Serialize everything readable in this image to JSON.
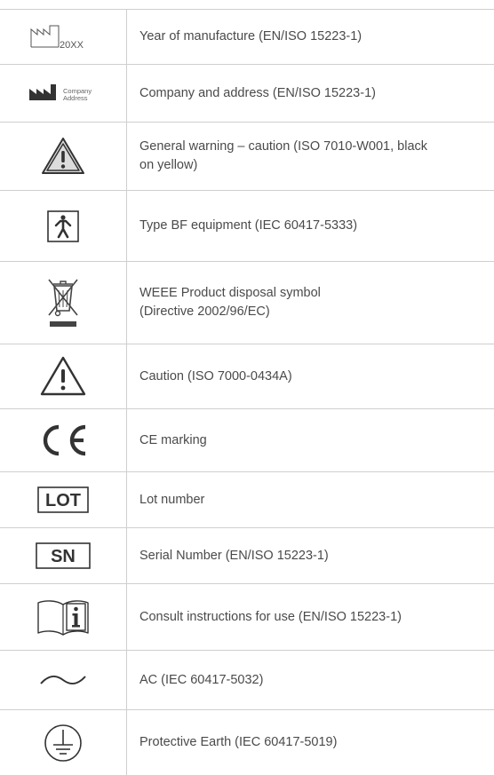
{
  "symbols": [
    {
      "icon": "date-of-manufacture-icon",
      "icon_text": "20XX",
      "description": "Year of manufacture (EN/ISO 15223-1)"
    },
    {
      "icon": "manufacturer-icon",
      "icon_text_line1": "Company",
      "icon_text_line2": "Address",
      "description": "Company and address (EN/ISO 15223-1)"
    },
    {
      "icon": "general-warning-icon",
      "description_line1": "General warning – caution (ISO 7010-W001, black",
      "description_line2": "on yellow)"
    },
    {
      "icon": "type-bf-equipment-icon",
      "description": "Type BF equipment (IEC 60417-5333)"
    },
    {
      "icon": "weee-disposal-icon",
      "description_line1": "WEEE Product disposal symbol",
      "description_line2": "(Directive 2002/96/EC)"
    },
    {
      "icon": "caution-icon",
      "description": "Caution (ISO 7000-0434A)"
    },
    {
      "icon": "ce-marking-icon",
      "description": "CE marking"
    },
    {
      "icon": "lot-number-icon",
      "icon_text": "LOT",
      "description": "Lot number"
    },
    {
      "icon": "serial-number-icon",
      "icon_text": "SN",
      "description": "Serial Number (EN/ISO 15223-1)"
    },
    {
      "icon": "consult-instructions-icon",
      "description": "Consult instructions for use (EN/ISO 15223-1)"
    },
    {
      "icon": "alternating-current-icon",
      "description": "AC (IEC 60417-5032)"
    },
    {
      "icon": "protective-earth-icon",
      "description": "Protective Earth (IEC 60417-5019)"
    }
  ]
}
